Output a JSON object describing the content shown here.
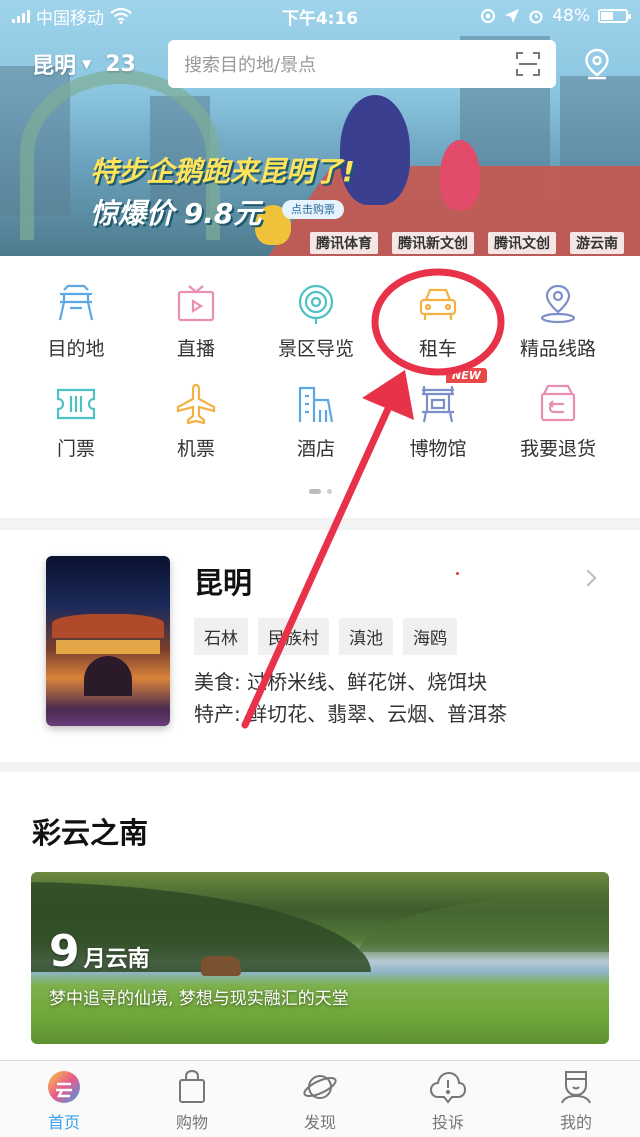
{
  "status_bar": {
    "carrier": "中国移动",
    "time": "下午4:16",
    "battery": "48%"
  },
  "header": {
    "city": "昆明",
    "temperature": "23",
    "search_placeholder": "搜索目的地/景点"
  },
  "banner": {
    "line1": "特步企鹅跑来昆明了!",
    "line2": "惊爆价 9.8元",
    "button": "点击购票",
    "sponsors": [
      "腾讯体育",
      "腾讯新文创",
      "腾讯文创",
      "游云南"
    ]
  },
  "menu": {
    "items": [
      {
        "label": "目的地",
        "icon": "destination-icon"
      },
      {
        "label": "直播",
        "icon": "live-icon"
      },
      {
        "label": "景区导览",
        "icon": "scenic-guide-icon"
      },
      {
        "label": "租车",
        "icon": "car-rental-icon"
      },
      {
        "label": "精品线路",
        "icon": "route-icon"
      },
      {
        "label": "门票",
        "icon": "ticket-icon"
      },
      {
        "label": "机票",
        "icon": "plane-icon"
      },
      {
        "label": "酒店",
        "icon": "hotel-icon"
      },
      {
        "label": "博物馆",
        "icon": "museum-icon"
      },
      {
        "label": "我要退货",
        "icon": "return-icon"
      }
    ],
    "new_badge": "NEW",
    "colors": {
      "blue": "#5aa9e6",
      "pink": "#e98fb4",
      "orange": "#f2b141",
      "teal": "#4fc1c4",
      "red_circle": "#e8324a"
    }
  },
  "city_card": {
    "name": "昆明",
    "tags": [
      "石林",
      "民族村",
      "滇池",
      "海鸥"
    ],
    "food": "美食: 过桥米线、鲜花饼、烧饵块",
    "specialty": "特产: 鲜切花、翡翠、云烟、普洱茶"
  },
  "section": {
    "title": "彩云之南",
    "feature_month": "9",
    "feature_month_suffix": "月云南",
    "feature_subtitle": "梦中追寻的仙境, 梦想与现实融汇的天堂"
  },
  "tabbar": {
    "tabs": [
      {
        "label": "首页",
        "active": true
      },
      {
        "label": "购物",
        "active": false
      },
      {
        "label": "发现",
        "active": false
      },
      {
        "label": "投诉",
        "active": false
      },
      {
        "label": "我的",
        "active": false
      }
    ],
    "accent": "#3aa0e8"
  }
}
